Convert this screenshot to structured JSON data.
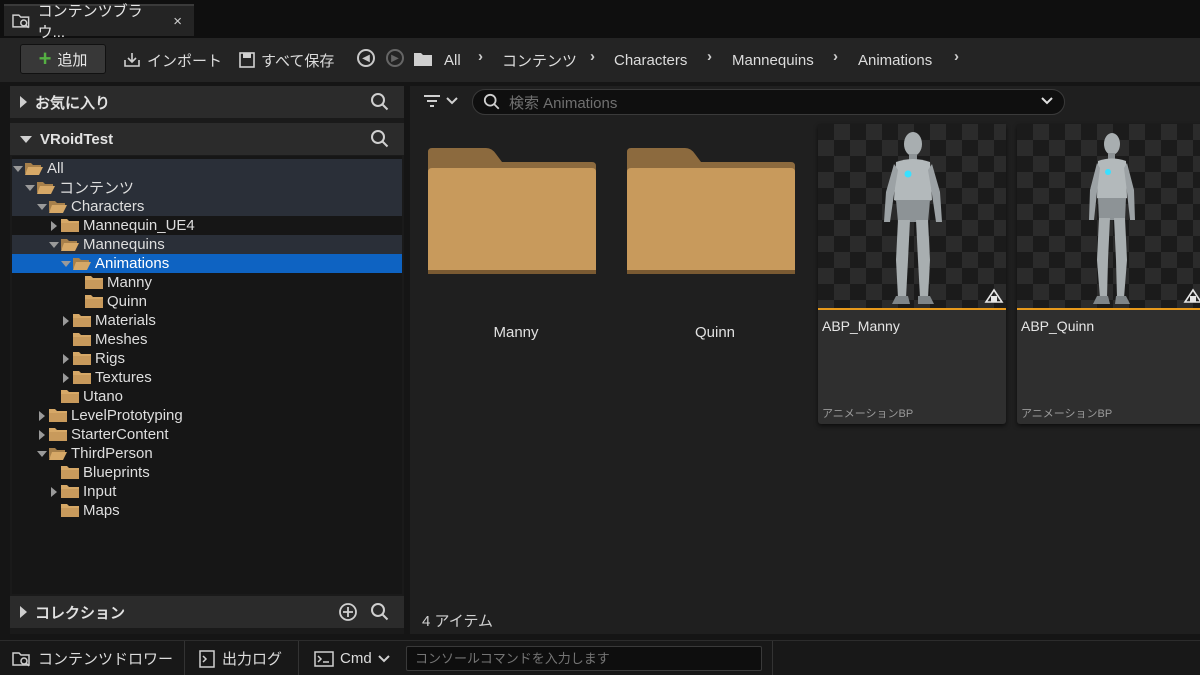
{
  "tab": {
    "title": "コンテンツブラウ...",
    "close": "×"
  },
  "toolbar": {
    "add_label": "追加",
    "import_label": "インポート",
    "save_all_label": "すべて保存",
    "breadcrumb": [
      "All",
      "コンテンツ",
      "Characters",
      "Mannequins",
      "Animations"
    ]
  },
  "left": {
    "favorites_title": "お気に入り",
    "project_title": "VRoidTest",
    "collections_title": "コレクション",
    "tree": [
      {
        "label": "All",
        "depth": 0,
        "expand": "open",
        "state": "hl"
      },
      {
        "label": "コンテンツ",
        "depth": 1,
        "expand": "open",
        "state": "hl"
      },
      {
        "label": "Characters",
        "depth": 2,
        "expand": "open",
        "state": "hl"
      },
      {
        "label": "Mannequin_UE4",
        "depth": 3,
        "expand": "closed",
        "state": ""
      },
      {
        "label": "Mannequins",
        "depth": 3,
        "expand": "open",
        "state": "hl"
      },
      {
        "label": "Animations",
        "depth": 4,
        "expand": "open",
        "state": "sel"
      },
      {
        "label": "Manny",
        "depth": 5,
        "expand": "none",
        "state": ""
      },
      {
        "label": "Quinn",
        "depth": 5,
        "expand": "none",
        "state": ""
      },
      {
        "label": "Materials",
        "depth": 4,
        "expand": "closed",
        "state": ""
      },
      {
        "label": "Meshes",
        "depth": 4,
        "expand": "none",
        "state": ""
      },
      {
        "label": "Rigs",
        "depth": 4,
        "expand": "closed",
        "state": ""
      },
      {
        "label": "Textures",
        "depth": 4,
        "expand": "closed",
        "state": ""
      },
      {
        "label": "Utano",
        "depth": 3,
        "expand": "none",
        "state": ""
      },
      {
        "label": "LevelPrototyping",
        "depth": 2,
        "expand": "closed",
        "state": ""
      },
      {
        "label": "StarterContent",
        "depth": 2,
        "expand": "closed",
        "state": ""
      },
      {
        "label": "ThirdPerson",
        "depth": 2,
        "expand": "open",
        "state": ""
      },
      {
        "label": "Blueprints",
        "depth": 3,
        "expand": "none",
        "state": ""
      },
      {
        "label": "Input",
        "depth": 3,
        "expand": "closed",
        "state": ""
      },
      {
        "label": "Maps",
        "depth": 3,
        "expand": "none",
        "state": ""
      }
    ]
  },
  "content": {
    "search_placeholder": "検索 Animations",
    "folders": [
      "Manny",
      "Quinn"
    ],
    "assets": [
      {
        "name": "ABP_Manny",
        "type": "アニメーションBP"
      },
      {
        "name": "ABP_Quinn",
        "type": "アニメーションBP"
      }
    ],
    "item_count": "4 アイテム"
  },
  "bottom": {
    "content_drawer": "コンテンツドロワー",
    "output_log": "出力ログ",
    "cmd": "Cmd",
    "console_placeholder": "コンソールコマンドを入力します"
  },
  "colors": {
    "accent": "#0e63c2",
    "folder": "#c89a5c",
    "add_plus": "#55b043",
    "asset_bar": "#e89a1c"
  }
}
